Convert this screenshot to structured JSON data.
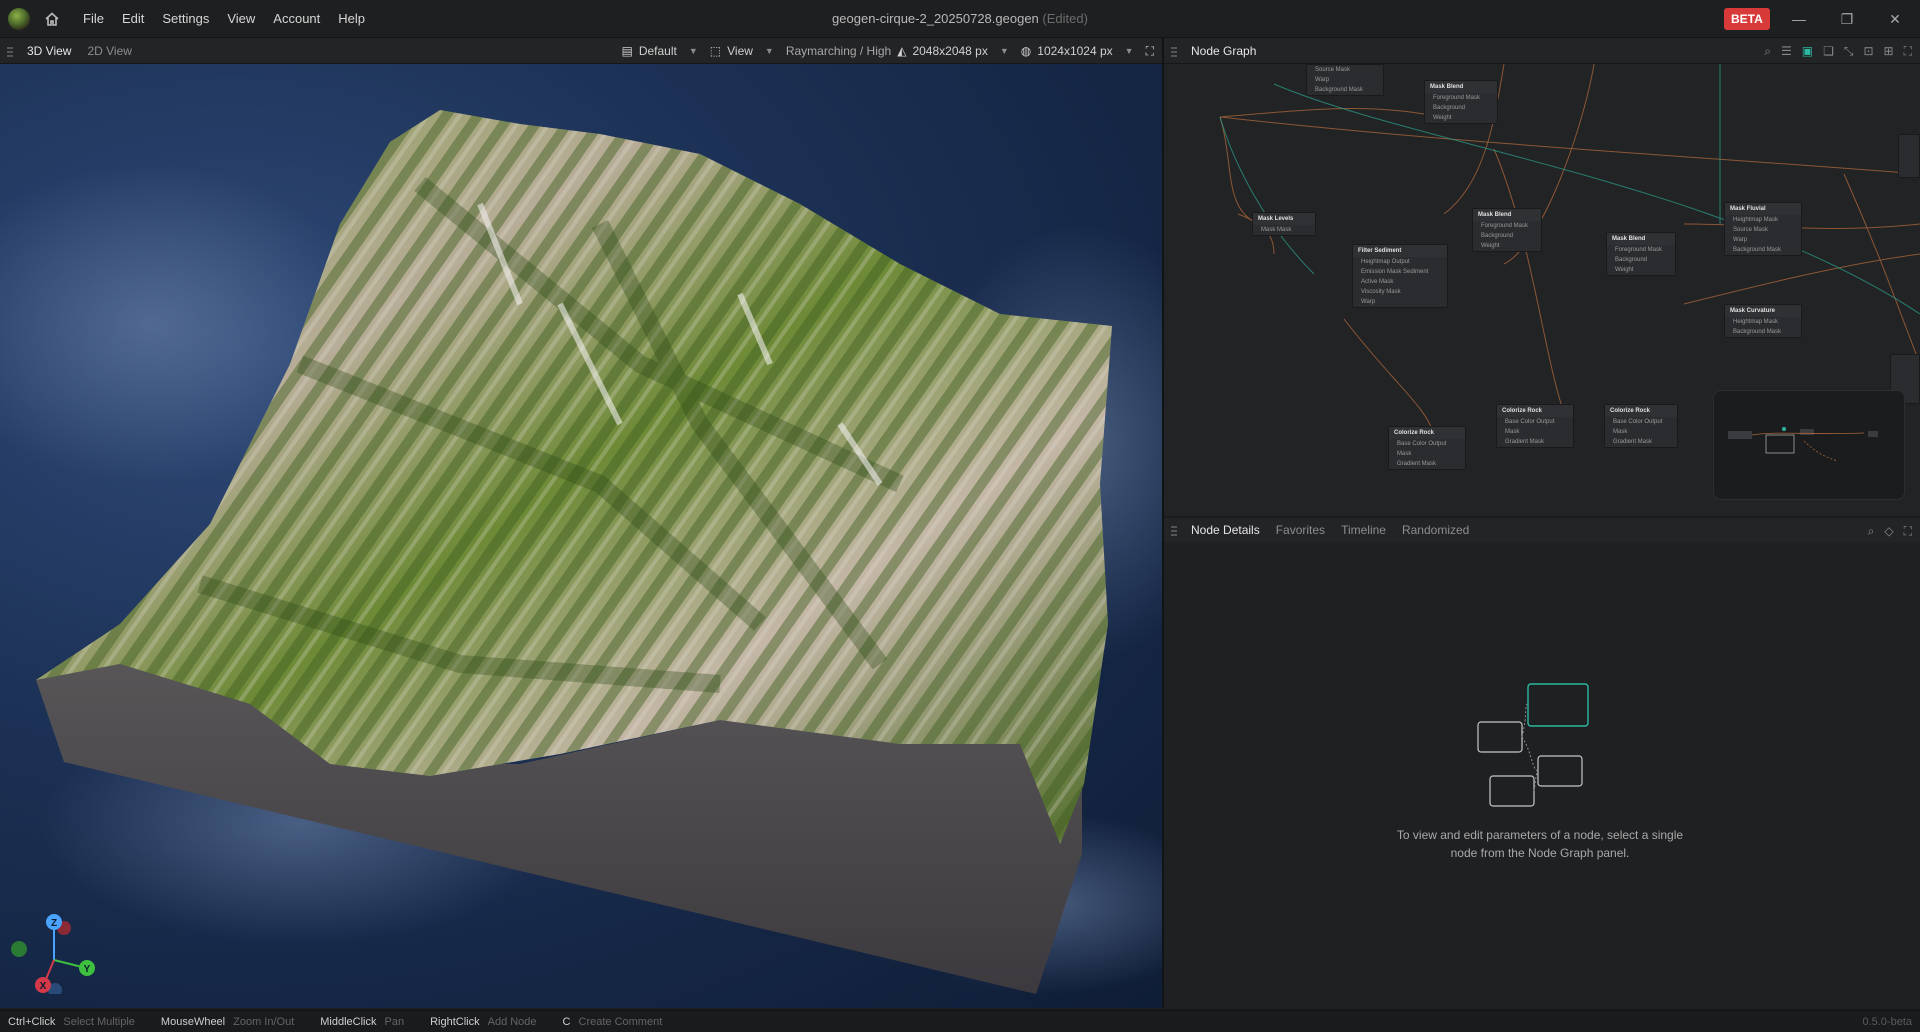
{
  "titlebar": {
    "menu": [
      "File",
      "Edit",
      "Settings",
      "View",
      "Account",
      "Help"
    ],
    "document": "geogen-cirque-2_20250728.geogen",
    "edited": "(Edited)",
    "beta": "BETA"
  },
  "viewport": {
    "tabs": [
      "3D View",
      "2D View"
    ],
    "preset": "Default",
    "view": "View",
    "render_mode": "Raymarching / High",
    "resolution": "2048x2048 px",
    "preview_resolution": "1024x1024 px",
    "gizmo": {
      "z": "Z",
      "y": "Y",
      "x": "X"
    }
  },
  "node_graph": {
    "title": "Node Graph",
    "nodes": [
      {
        "id": "n0",
        "title": "",
        "rows": [
          "Source Mask",
          "Warp",
          "Background Mask"
        ]
      },
      {
        "id": "n1",
        "title": "Mask Blend",
        "rows": [
          "Foreground   Mask",
          "Background",
          "Weight"
        ]
      },
      {
        "id": "n2",
        "title": "Mask Levels",
        "rows": [
          "Mask   Mask"
        ]
      },
      {
        "id": "n3",
        "title": "Filter Sediment",
        "rows": [
          "Heightmap   Output",
          "Emission Mask   Sediment",
          "Active Mask",
          "Viscosity Mask",
          "Warp"
        ]
      },
      {
        "id": "n4",
        "title": "Mask Blend",
        "rows": [
          "Foreground   Mask",
          "Background",
          "Weight"
        ]
      },
      {
        "id": "n5",
        "title": "Mask Blend",
        "rows": [
          "Foreground   Mask",
          "Background",
          "Weight"
        ]
      },
      {
        "id": "n6",
        "title": "Mask Fluvial",
        "rows": [
          "Heightmap   Mask",
          "Source Mask",
          "Warp",
          "Background Mask"
        ]
      },
      {
        "id": "n7",
        "title": "Mask Curvature",
        "rows": [
          "Heightmap   Mask",
          "Background Mask"
        ]
      },
      {
        "id": "n8",
        "title": "Colorize Rock",
        "rows": [
          "Base Color   Output",
          "Mask",
          "Gradient Mask"
        ]
      },
      {
        "id": "n9",
        "title": "Colorize Rock",
        "rows": [
          "Base Color   Output",
          "Mask",
          "Gradient Mask"
        ]
      },
      {
        "id": "n10",
        "title": "Colorize Rock",
        "rows": [
          "Base Color   Output",
          "Mask",
          "Gradient Mask"
        ]
      }
    ]
  },
  "details": {
    "tabs": [
      "Node Details",
      "Favorites",
      "Timeline",
      "Randomized"
    ],
    "hint": "To view and edit parameters of a node, select a single node from the Node Graph panel."
  },
  "statusbar": {
    "items": [
      {
        "key": "Ctrl+Click",
        "value": "Select Multiple"
      },
      {
        "key": "MouseWheel",
        "value": "Zoom In/Out"
      },
      {
        "key": "MiddleClick",
        "value": "Pan"
      },
      {
        "key": "RightClick",
        "value": "Add Node"
      },
      {
        "key": "C",
        "value": "Create Comment"
      }
    ],
    "version": "0.5.0-beta"
  },
  "colors": {
    "beta": "#d83a3a",
    "accent": "#2bb7a0",
    "gizmo_x": "#d4394a",
    "gizmo_y": "#3fbf3f",
    "gizmo_z": "#4aa3ff"
  }
}
